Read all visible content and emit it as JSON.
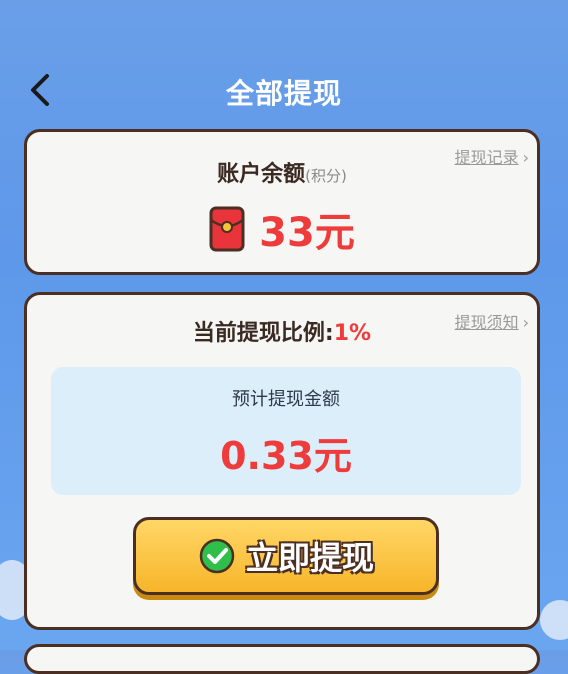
{
  "header": {
    "title": "全部提现",
    "back_icon": "chevron-left-icon"
  },
  "balance_card": {
    "history_link": "提现记录",
    "title": "账户余额",
    "title_sub": "(积分)",
    "amount": "33元",
    "icon": "red-envelope-icon"
  },
  "withdraw_card": {
    "notice_link": "提现须知",
    "rate_label": "当前提现比例:",
    "rate_value": "1%",
    "estimate_label": "预计提现金额",
    "estimate_amount": "0.33元",
    "button_label": "立即提现",
    "button_icon": "wechat-check-icon"
  },
  "colors": {
    "accent_red": "#ee3b3b",
    "button_yellow": "#f7b52a",
    "border_brown": "#4a2f22",
    "background_blue": "#6a9fe8"
  }
}
